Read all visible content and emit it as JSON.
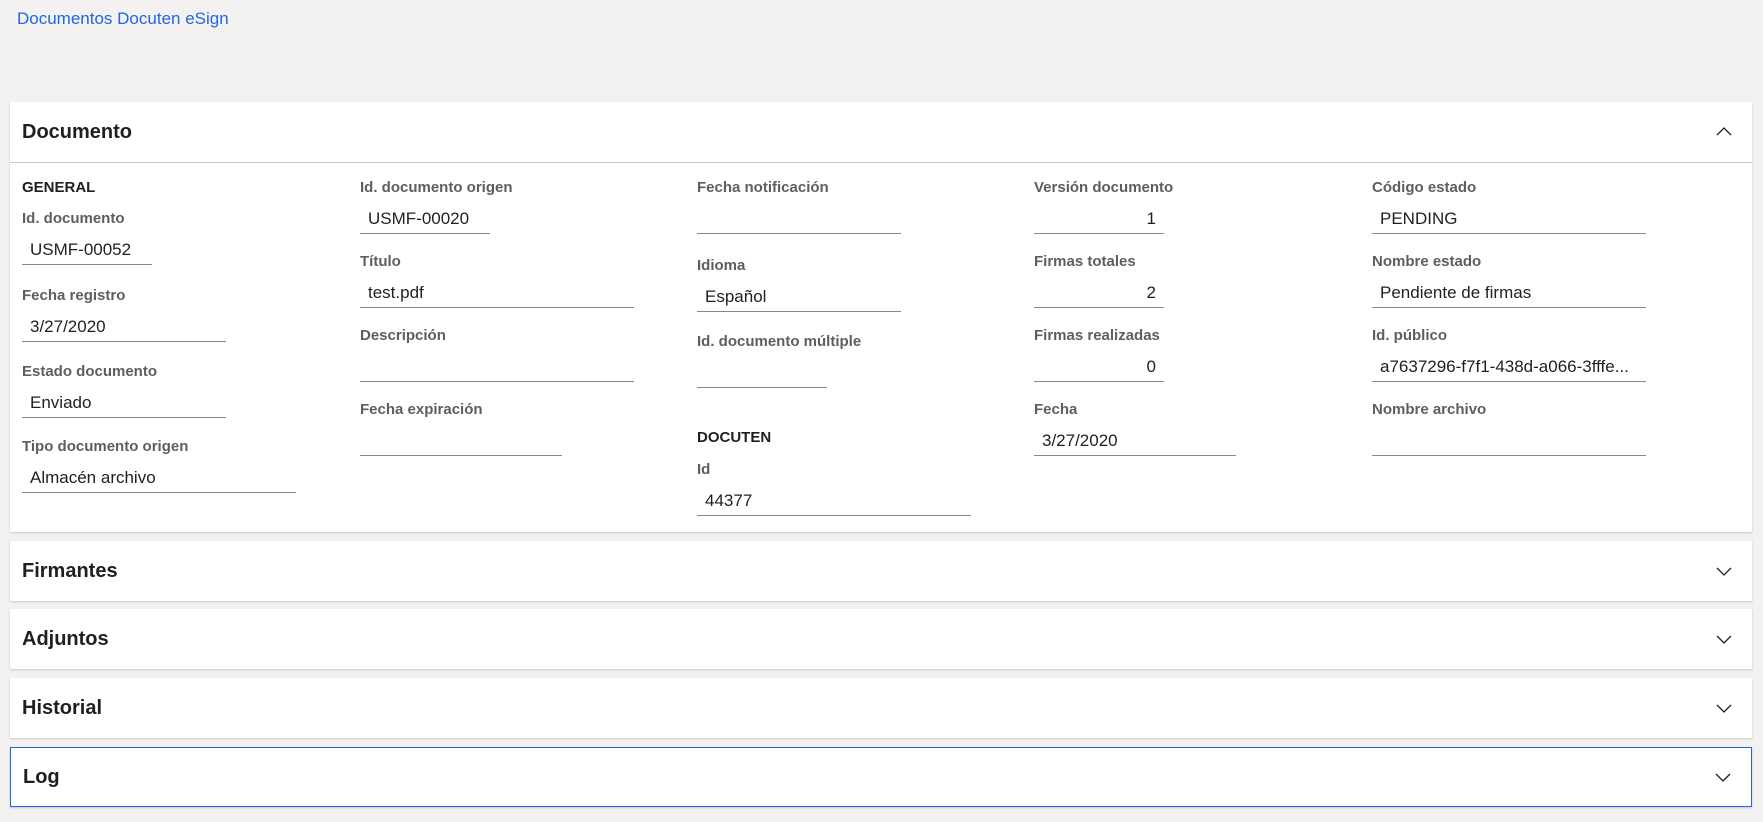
{
  "breadcrumb": "Documentos Docuten eSign",
  "sections": {
    "documento": "Documento",
    "firmantes": "Firmantes",
    "adjuntos": "Adjuntos",
    "historial": "Historial",
    "log": "Log"
  },
  "general": {
    "title": "GENERAL",
    "id_documento": {
      "label": "Id. documento",
      "value": "USMF-00052"
    },
    "fecha_registro": {
      "label": "Fecha registro",
      "value": "3/27/2020"
    },
    "estado_documento": {
      "label": "Estado documento",
      "value": "Enviado"
    },
    "tipo_documento_origen": {
      "label": "Tipo documento origen",
      "value": "Almacén archivo"
    }
  },
  "col2": {
    "id_documento_origen": {
      "label": "Id. documento origen",
      "value": "USMF-00020"
    },
    "titulo": {
      "label": "Título",
      "value": "test.pdf"
    },
    "descripcion": {
      "label": "Descripción",
      "value": ""
    },
    "fecha_expiracion": {
      "label": "Fecha expiración",
      "value": ""
    }
  },
  "col3": {
    "fecha_notificacion": {
      "label": "Fecha notificación",
      "value": ""
    },
    "idioma": {
      "label": "Idioma",
      "value": "Español"
    },
    "id_documento_multiple": {
      "label": "Id. documento múltiple",
      "value": ""
    }
  },
  "docuten": {
    "title": "DOCUTEN",
    "id": {
      "label": "Id",
      "value": "44377"
    }
  },
  "col4": {
    "version_documento": {
      "label": "Versión documento",
      "value": "1"
    },
    "firmas_totales": {
      "label": "Firmas totales",
      "value": "2"
    },
    "firmas_realizadas": {
      "label": "Firmas realizadas",
      "value": "0"
    },
    "fecha": {
      "label": "Fecha",
      "value": "3/27/2020"
    }
  },
  "col5": {
    "codigo_estado": {
      "label": "Código estado",
      "value": "PENDING"
    },
    "nombre_estado": {
      "label": "Nombre estado",
      "value": "Pendiente de firmas"
    },
    "id_publico": {
      "label": "Id. público",
      "value": "a7637296-f7f1-438d-a066-3fffe..."
    },
    "nombre_archivo": {
      "label": "Nombre archivo",
      "value": ""
    }
  }
}
